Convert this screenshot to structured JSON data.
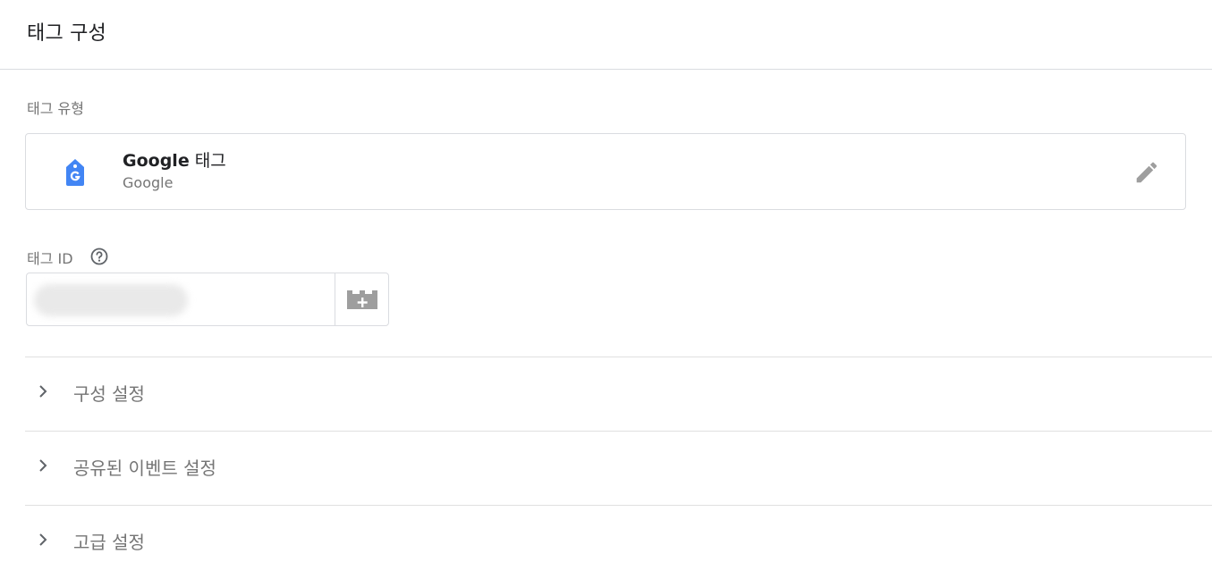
{
  "header": {
    "title": "태그 구성"
  },
  "tag_type": {
    "section_label": "태그 유형",
    "name_prefix": "Google",
    "name_suffix": " 태그",
    "vendor": "Google",
    "icon": "google-tag-icon"
  },
  "tag_id": {
    "label": "태그 ID",
    "value": "",
    "help_icon": "help-circle-icon",
    "variable_icon": "variable-insert-icon"
  },
  "accordion": [
    {
      "label": "구성 설정"
    },
    {
      "label": "공유된 이벤트 설정"
    },
    {
      "label": "고급 설정"
    }
  ],
  "colors": {
    "google_blue": "#4285f4",
    "icon_gray": "#9e9e9e",
    "border": "#dadce0",
    "secondary_text": "#757575"
  }
}
